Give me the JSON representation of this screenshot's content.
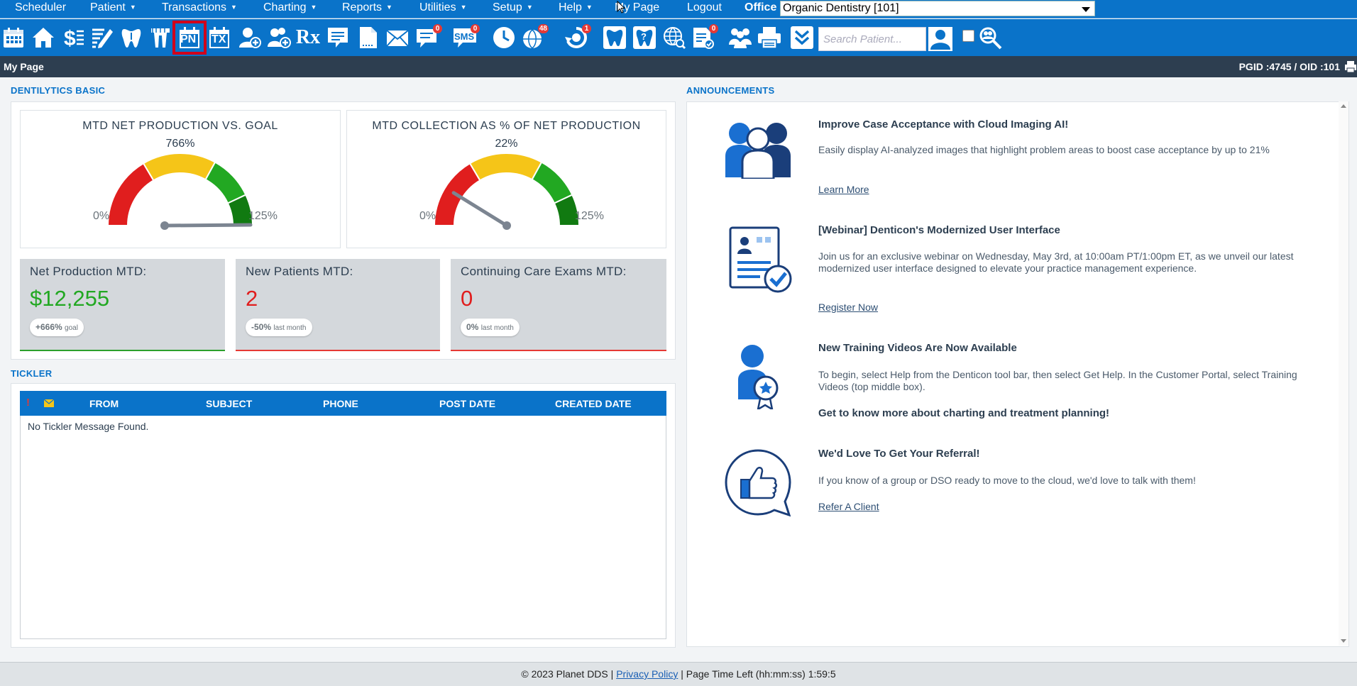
{
  "menu": {
    "items": [
      {
        "label": "Scheduler",
        "caret": false
      },
      {
        "label": "Patient",
        "caret": true
      },
      {
        "label": "Transactions",
        "caret": true
      },
      {
        "label": "Charting",
        "caret": true
      },
      {
        "label": "Reports",
        "caret": true
      },
      {
        "label": "Utilities",
        "caret": true
      },
      {
        "label": "Setup",
        "caret": true
      },
      {
        "label": "Help",
        "caret": true
      },
      {
        "label": "My Page",
        "caret": false
      },
      {
        "label": "Logout",
        "caret": false
      }
    ],
    "office_label": "Office",
    "office_selected": "Organic Dentistry [101]"
  },
  "toolbar": {
    "icons": [
      {
        "name": "calendar-icon"
      },
      {
        "name": "home-icon"
      },
      {
        "name": "dollar-icon"
      },
      {
        "name": "edit-list-icon"
      },
      {
        "name": "tooth-chart-icon"
      },
      {
        "name": "tooth-perio-icon"
      },
      {
        "name": "progress-notes-icon",
        "text": "PN"
      },
      {
        "name": "treatment-plan-icon",
        "text": "TX"
      },
      {
        "name": "add-patient-icon"
      },
      {
        "name": "add-family-icon"
      },
      {
        "name": "prescription-icon",
        "text": "Rx"
      },
      {
        "name": "notes-icon"
      },
      {
        "name": "document-icon"
      },
      {
        "name": "email-icon"
      },
      {
        "name": "messages-icon",
        "badge": "0"
      },
      {
        "name": "sms-icon",
        "text": "SMS",
        "badge": "0"
      },
      {
        "name": "clock-icon"
      },
      {
        "name": "web-icon",
        "badge": "48"
      },
      {
        "name": "recall-icon",
        "badge": "1"
      },
      {
        "name": "tooth-icon"
      },
      {
        "name": "tooth-question-icon"
      },
      {
        "name": "globe-search-icon"
      },
      {
        "name": "forms-icon",
        "badge": "0"
      },
      {
        "name": "group-icon"
      },
      {
        "name": "printer-icon"
      },
      {
        "name": "expand-down-icon"
      }
    ],
    "search_placeholder": "Search Patient..."
  },
  "page": {
    "title": "My Page",
    "ids": "PGID :4745  /  OID :101"
  },
  "dentilytics": {
    "section_title": "DENTILYTICS BASIC",
    "gauges": [
      {
        "title": "MTD NET PRODUCTION VS. GOAL",
        "value_label": "766%",
        "min_label": "0%",
        "max_label": "125%",
        "value_pct": 766,
        "max_pct": 125
      },
      {
        "title": "MTD COLLECTION AS % OF NET PRODUCTION",
        "value_label": "22%",
        "min_label": "0%",
        "max_label": "125%",
        "value_pct": 22,
        "max_pct": 125
      }
    ],
    "kpis": [
      {
        "label": "Net Production MTD:",
        "value": "$12,255",
        "pill_value": "+666%",
        "pill_suffix": "goal",
        "color": "#22a822"
      },
      {
        "label": "New Patients MTD:",
        "value": "2",
        "pill_value": "-50%",
        "pill_suffix": "last month",
        "color": "#e01e1e"
      },
      {
        "label": "Continuing Care Exams MTD:",
        "value": "0",
        "pill_value": "0%",
        "pill_suffix": "last month",
        "color": "#e01e1e"
      }
    ]
  },
  "tickler": {
    "section_title": "TICKLER",
    "columns": [
      "FROM",
      "SUBJECT",
      "PHONE",
      "POST DATE",
      "CREATED DATE"
    ],
    "priority_symbol": "!",
    "empty_message": "No Tickler Message Found."
  },
  "announcements": {
    "section_title": "ANNOUNCEMENTS",
    "items": [
      {
        "title": "Improve Case Acceptance with Cloud Imaging AI!",
        "body": "Easily display AI-analyzed images that highlight problem areas to boost case acceptance by up to 21%",
        "link": "Learn More"
      },
      {
        "title": "[Webinar] Denticon's Modernized User Interface",
        "body": "Join us for an exclusive webinar on Wednesday, May 3rd, at 10:00am PT/1:00pm ET, as we unveil our latest modernized user interface designed to elevate your practice management experience.",
        "link": "Register Now"
      },
      {
        "title": "New Training Videos Are Now Available",
        "body": "To begin, select Help from the Denticon tool bar, then select Get Help. In the Customer Portal, select Training Videos (top middle box).",
        "bold": "Get to know more about charting and treatment planning!"
      },
      {
        "title": "We'd Love To Get Your Referral!",
        "body": "If you know of a group or DSO ready to move to the cloud, we'd love to talk with them!",
        "link": "Refer A Client"
      }
    ]
  },
  "footer": {
    "copyright": "© 2023 Planet DDS | ",
    "privacy": "Privacy Policy",
    "time_left": " |  Page Time Left (hh:mm:ss) 1:59:5"
  },
  "colors": {
    "brand_blue": "#0a73c9",
    "header_dark": "#2d3e50",
    "gauge_red": "#e01e1e",
    "gauge_yellow": "#f5c518",
    "gauge_green": "#22a822",
    "gauge_dark_green": "#117a11",
    "highlight": "#d0021b"
  }
}
